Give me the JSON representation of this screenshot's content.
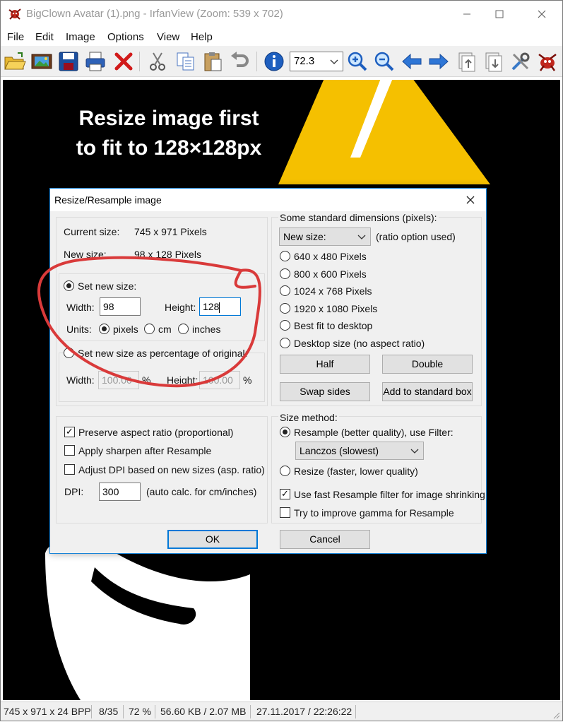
{
  "window": {
    "title": "BigClown Avatar (1).png - IrfanView (Zoom: 539 x 702)"
  },
  "menu": [
    "File",
    "Edit",
    "Image",
    "Options",
    "View",
    "Help"
  ],
  "toolbar": {
    "zoom_value": "72.3"
  },
  "canvas": {
    "annotation_line1": "Resize image first",
    "annotation_line2": "to fit to 128×128px"
  },
  "dialog": {
    "title": "Resize/Resample image",
    "current_size_label": "Current size:",
    "current_size_value": "745  x  971  Pixels",
    "new_size_label": "New size:",
    "new_size_value": "98  x  128  Pixels",
    "set_new_size_label": "Set new size:",
    "width_label": "Width:",
    "width_value": "98",
    "height_label": "Height:",
    "height_value": "128",
    "units_label": "Units:",
    "unit_pixels": "pixels",
    "unit_cm": "cm",
    "unit_inches": "inches",
    "percent_label": "Set new size as percentage of original:",
    "percent_width_label": "Width:",
    "percent_width_value": "100.00",
    "percent_height_label": "Height:",
    "percent_height_value": "100.00",
    "percent_sign": "%",
    "preserve_aspect": "Preserve aspect ratio (proportional)",
    "apply_sharpen": "Apply sharpen after Resample",
    "adjust_dpi": "Adjust DPI based on new sizes (asp. ratio)",
    "dpi_label": "DPI:",
    "dpi_value": "300",
    "dpi_note": "(auto calc. for cm/inches)",
    "std_dims_label": "Some standard dimensions (pixels):",
    "std_select_value": "New size:",
    "std_ratio_note": "(ratio option used)",
    "std_options": [
      "640 x 480 Pixels",
      "800 x 600 Pixels",
      "1024 x 768 Pixels",
      "1920 x 1080 Pixels",
      "Best fit to desktop",
      "Desktop size (no aspect ratio)"
    ],
    "half_button": "Half",
    "double_button": "Double",
    "swap_button": "Swap sides",
    "add_std_button": "Add to standard box",
    "size_method_label": "Size method:",
    "resample_label": "Resample (better quality), use Filter:",
    "filter_value": "Lanczos (slowest)",
    "resize_label": "Resize (faster, lower quality)",
    "fast_resample": "Use fast Resample filter for image shrinking",
    "improve_gamma": "Try to improve gamma for Resample",
    "ok_button": "OK",
    "cancel_button": "Cancel"
  },
  "status": {
    "dimensions": "745 x 971 x 24 BPP",
    "index": "8/35",
    "zoom": "72 %",
    "filesize": "56.60 KB / 2.07 MB",
    "datetime": "27.11.2017 / 22:26:22"
  },
  "colors": {
    "accent": "#0078d7",
    "annotation_red": "#d93a3a",
    "triangle_yellow": "#f5c000"
  }
}
